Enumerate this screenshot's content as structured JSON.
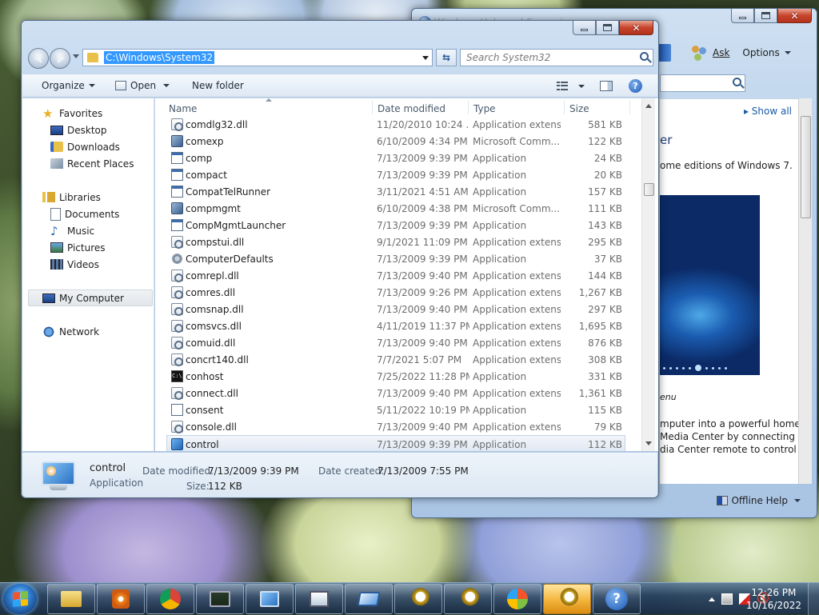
{
  "help_window": {
    "title": "Windows Help and Support",
    "toolbar": {
      "ask_label": "Ask",
      "options_label": "Options"
    },
    "show_all": "Show all",
    "heading_fragment": "er",
    "text_line": "ome editions of Windows 7.",
    "caption_fragment": "enu",
    "paragraph_lines": [
      "mputer into a powerful home",
      "Media Center by connecting",
      "dia Center remote to control"
    ],
    "offline_help": "Offline Help"
  },
  "explorer": {
    "address_path": "C:\\Windows\\System32",
    "search_placeholder": "Search System32",
    "commands": {
      "organize": "Organize",
      "open": "Open",
      "new_folder": "New folder"
    },
    "nav": {
      "favorites": "Favorites",
      "desktop": "Desktop",
      "downloads": "Downloads",
      "recent_places": "Recent Places",
      "libraries": "Libraries",
      "documents": "Documents",
      "music": "Music",
      "pictures": "Pictures",
      "videos": "Videos",
      "my_computer": "My Computer",
      "network": "Network"
    },
    "columns": {
      "name": "Name",
      "date": "Date modified",
      "type": "Type",
      "size": "Size"
    },
    "files": [
      {
        "name": "comdlg32.dll",
        "date": "11/20/2010 10:24 ...",
        "type": "Application extens...",
        "size": "581 KB",
        "icon": "dll"
      },
      {
        "name": "comexp",
        "date": "6/10/2009 4:34 PM",
        "type": "Microsoft Comm...",
        "size": "122 KB",
        "icon": "msc"
      },
      {
        "name": "comp",
        "date": "7/13/2009 9:39 PM",
        "type": "Application",
        "size": "24 KB",
        "icon": "app"
      },
      {
        "name": "compact",
        "date": "7/13/2009 9:39 PM",
        "type": "Application",
        "size": "20 KB",
        "icon": "app"
      },
      {
        "name": "CompatTelRunner",
        "date": "3/11/2021 4:51 AM",
        "type": "Application",
        "size": "157 KB",
        "icon": "app"
      },
      {
        "name": "compmgmt",
        "date": "6/10/2009 4:38 PM",
        "type": "Microsoft Comm...",
        "size": "111 KB",
        "icon": "msc"
      },
      {
        "name": "CompMgmtLauncher",
        "date": "7/13/2009 9:39 PM",
        "type": "Application",
        "size": "143 KB",
        "icon": "app"
      },
      {
        "name": "compstui.dll",
        "date": "9/1/2021 11:09 PM",
        "type": "Application extens...",
        "size": "295 KB",
        "icon": "dll"
      },
      {
        "name": "ComputerDefaults",
        "date": "7/13/2009 9:39 PM",
        "type": "Application",
        "size": "37 KB",
        "icon": "gear"
      },
      {
        "name": "comrepl.dll",
        "date": "7/13/2009 9:40 PM",
        "type": "Application extens...",
        "size": "144 KB",
        "icon": "dll"
      },
      {
        "name": "comres.dll",
        "date": "7/13/2009 9:26 PM",
        "type": "Application extens...",
        "size": "1,267 KB",
        "icon": "dll"
      },
      {
        "name": "comsnap.dll",
        "date": "7/13/2009 9:40 PM",
        "type": "Application extens...",
        "size": "297 KB",
        "icon": "dll"
      },
      {
        "name": "comsvcs.dll",
        "date": "4/11/2019 11:37 PM",
        "type": "Application extens...",
        "size": "1,695 KB",
        "icon": "dll"
      },
      {
        "name": "comuid.dll",
        "date": "7/13/2009 9:40 PM",
        "type": "Application extens...",
        "size": "876 KB",
        "icon": "dll"
      },
      {
        "name": "concrt140.dll",
        "date": "7/7/2021 5:07 PM",
        "type": "Application extens...",
        "size": "308 KB",
        "icon": "dll"
      },
      {
        "name": "conhost",
        "date": "7/25/2022 11:28 PM",
        "type": "Application",
        "size": "331 KB",
        "icon": "console"
      },
      {
        "name": "connect.dll",
        "date": "7/13/2009 9:40 PM",
        "type": "Application extens...",
        "size": "1,361 KB",
        "icon": "dll"
      },
      {
        "name": "consent",
        "date": "5/11/2022 10:19 PM",
        "type": "Application",
        "size": "115 KB",
        "icon": "consent"
      },
      {
        "name": "console.dll",
        "date": "7/13/2009 9:40 PM",
        "type": "Application extens...",
        "size": "79 KB",
        "icon": "dll"
      },
      {
        "name": "control",
        "date": "7/13/2009 9:39 PM",
        "type": "Application",
        "size": "112 KB",
        "icon": "cp",
        "selected": true
      }
    ],
    "details": {
      "name": "control",
      "type": "Application",
      "date_modified_label": "Date modified:",
      "date_modified": "7/13/2009 9:39 PM",
      "date_created_label": "Date created:",
      "date_created": "7/13/2009 7:55 PM",
      "size_label": "Size:",
      "size": "112 KB"
    }
  },
  "taskbar": {
    "buttons": [
      "explorer",
      "media-player",
      "chrome",
      "task-manager",
      "control-panel",
      "remote-desktop",
      "windows-tool",
      "search-app",
      "search-app-2",
      "windows-media-center",
      "search-app-3",
      "help"
    ],
    "active_index": 10,
    "clock_time": "12:26 PM",
    "clock_date": "10/16/2022"
  }
}
